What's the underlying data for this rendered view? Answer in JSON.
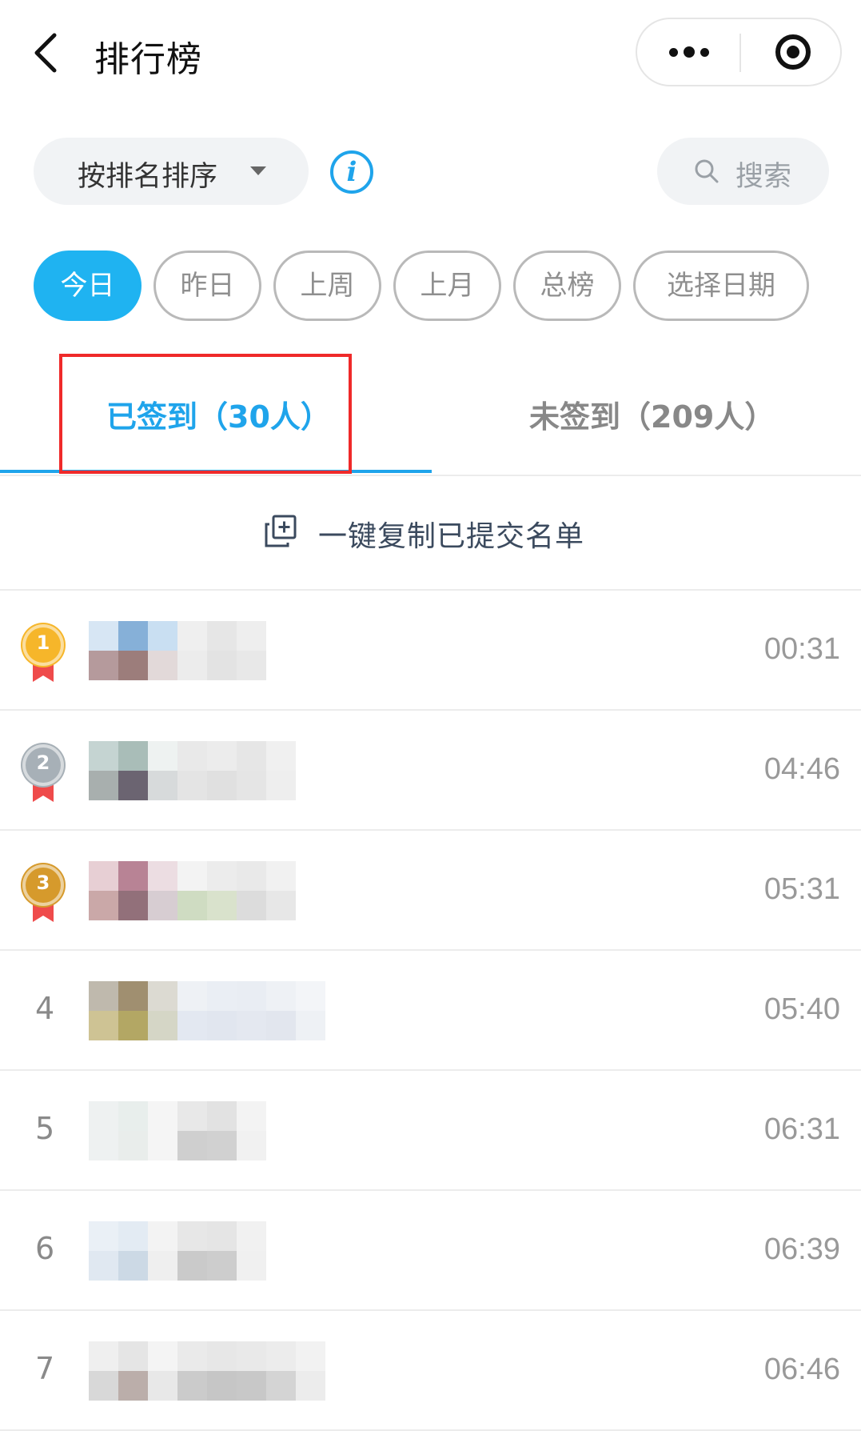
{
  "header": {
    "title": "排行榜",
    "back_icon": "chevron-left-icon",
    "more_icon": "more-dots-icon",
    "target_icon": "record-target-icon"
  },
  "toolbar": {
    "sort_label": "按排名排序",
    "info_glyph": "i",
    "search_placeholder": "搜索"
  },
  "date_filters": {
    "items": [
      "今日",
      "昨日",
      "上周",
      "上月",
      "总榜",
      "选择日期"
    ],
    "active": "今日"
  },
  "tabs": {
    "checked": "已签到（30人）",
    "unchecked": "未签到（209人）",
    "active": "checked"
  },
  "copy_action": {
    "label": "一键复制已提交名单"
  },
  "ranking": [
    {
      "rank": "1",
      "medal": "gold",
      "time": "00:31"
    },
    {
      "rank": "2",
      "medal": "silver",
      "time": "04:46"
    },
    {
      "rank": "3",
      "medal": "bronze",
      "time": "05:31"
    },
    {
      "rank": "4",
      "time": "05:40"
    },
    {
      "rank": "5",
      "time": "06:31"
    },
    {
      "rank": "6",
      "time": "06:39"
    },
    {
      "rank": "7",
      "time": "06:46"
    }
  ],
  "colors": {
    "accent": "#1fa4eb",
    "chip_active": "#1fb3f1",
    "highlight_box": "#ef2a2a",
    "gold": "#f6b62a",
    "silver": "#a7b0b7",
    "bronze": "#d69a2c",
    "ribbon": "#ef4b4b"
  }
}
